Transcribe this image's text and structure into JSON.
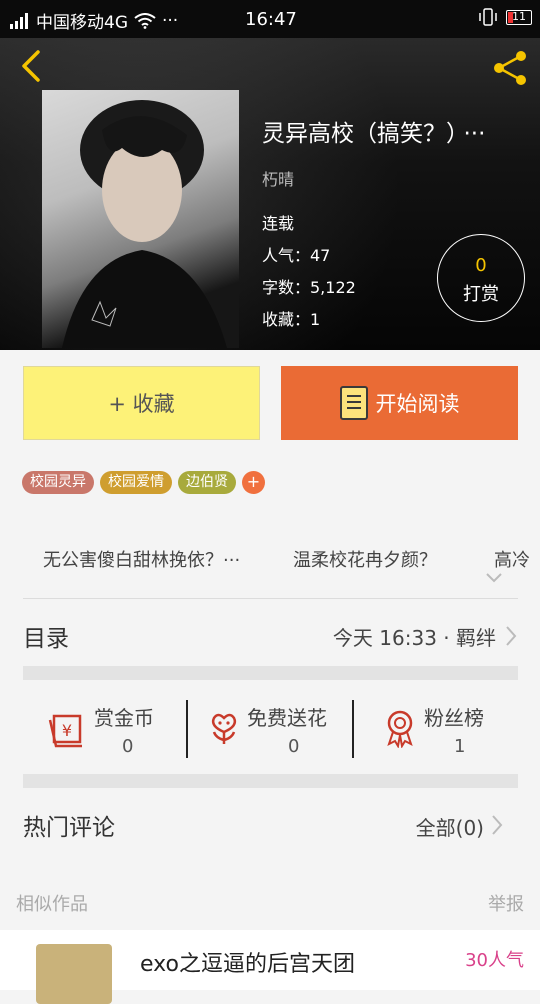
{
  "status_bar": {
    "carrier": "中国移动4G",
    "dots": "···",
    "time": "16:47",
    "battery": "11"
  },
  "book": {
    "title": "灵异高校（搞笑？）",
    "more": "···",
    "author": "朽晴",
    "status": "连载",
    "popularity": "人气：47",
    "word_count": "字数：5,122",
    "favorites": "收藏：1"
  },
  "reward": {
    "count": "0",
    "label": "打赏"
  },
  "actions": {
    "collect": "+ 收藏",
    "read": "开始阅读"
  },
  "tags": [
    {
      "label": "校园灵异",
      "color": "#c9776a"
    },
    {
      "label": "校园爱情",
      "color": "#cf9e2f"
    },
    {
      "label": "边伯贤",
      "color": "#a8aa3c"
    }
  ],
  "tag_add": "+",
  "related_titles": [
    "无公害傻白甜林挽依？···",
    "温柔校花冉夕颜？",
    "高冷"
  ],
  "toc": {
    "label": "目录",
    "latest": "今天 16:33 · 羁绊"
  },
  "stats": [
    {
      "label": "赏金币",
      "value": "0",
      "icon": "money-envelope-icon"
    },
    {
      "label": "免费送花",
      "value": "0",
      "icon": "flower-icon"
    },
    {
      "label": "粉丝榜",
      "value": "1",
      "icon": "medal-icon"
    }
  ],
  "comments": {
    "title": "热门评论",
    "all": "全部(0)"
  },
  "similar": {
    "label": "相似作品",
    "report": "举报",
    "first_title": "exo之逗逼的后宫天团",
    "first_pop": "30人气"
  },
  "colors": {
    "accent_yellow": "#f5c400",
    "collect_bg": "#fdf278",
    "read_bg": "#ea6b35",
    "icon_red": "#c83a2a"
  }
}
